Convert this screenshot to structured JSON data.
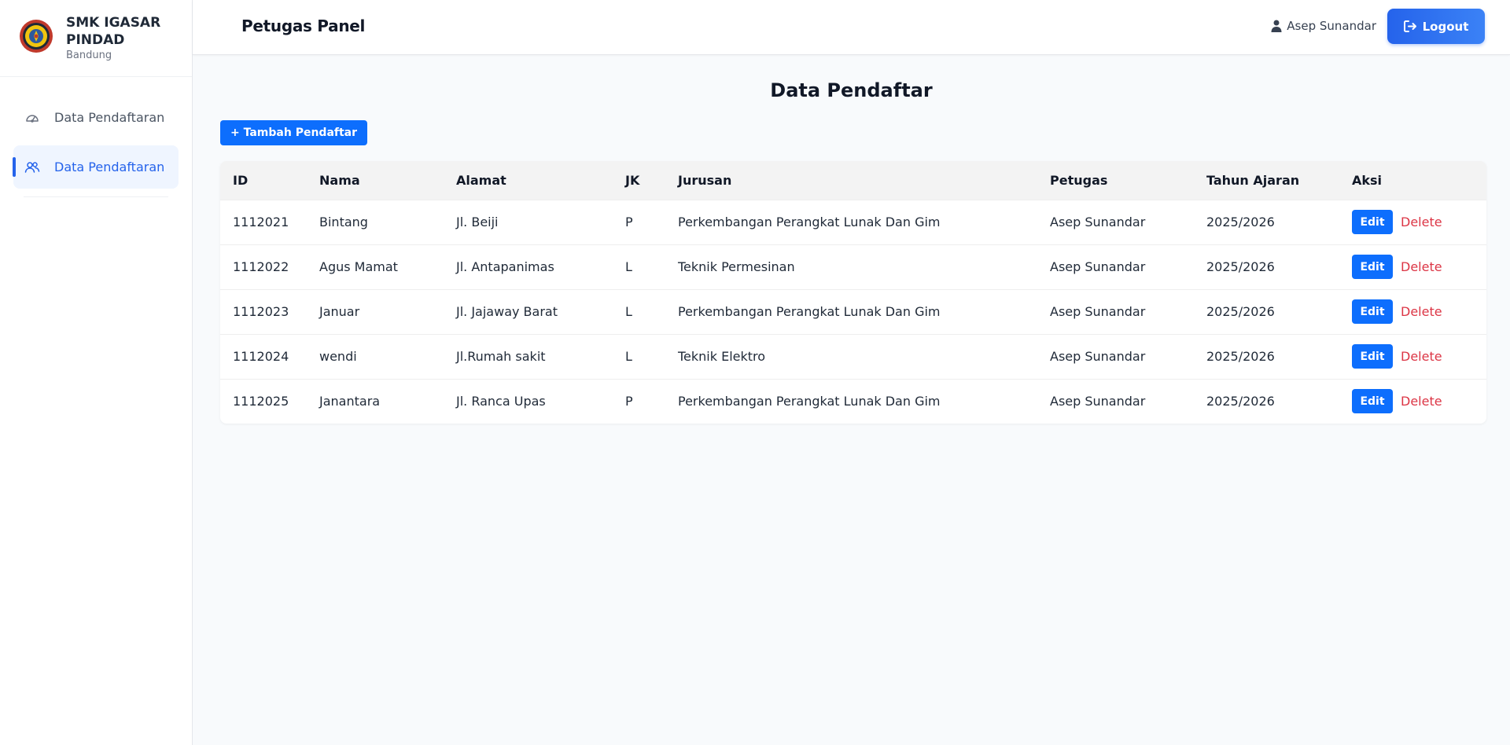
{
  "brand": {
    "name": "SMK IGASAR PINDAD",
    "subtitle": "Bandung"
  },
  "sidebar": {
    "items": [
      {
        "label": "Data Pendaftaran",
        "icon": "dashboard-gauge-icon",
        "active": false
      },
      {
        "label": "Data Pendaftaran",
        "icon": "users-icon",
        "active": true
      }
    ]
  },
  "header": {
    "title": "Petugas Panel",
    "user_name": "Asep Sunandar",
    "logout_label": "Logout"
  },
  "main": {
    "title": "Data Pendaftar",
    "add_button": "+ Tambah Pendaftar",
    "columns": [
      "ID",
      "Nama",
      "Alamat",
      "JK",
      "Jurusan",
      "Petugas",
      "Tahun Ajaran",
      "Aksi"
    ],
    "rows": [
      {
        "id": "1112021",
        "nama": "Bintang",
        "alamat": "Jl. Beiji",
        "jk": "P",
        "jurusan": "Perkembangan Perangkat Lunak Dan Gim",
        "petugas": "Asep Sunandar",
        "tahun": "2025/2026"
      },
      {
        "id": "1112022",
        "nama": "Agus Mamat",
        "alamat": "Jl. Antapanimas",
        "jk": "L",
        "jurusan": "Teknik Permesinan",
        "petugas": "Asep Sunandar",
        "tahun": "2025/2026"
      },
      {
        "id": "1112023",
        "nama": "Januar",
        "alamat": "Jl. Jajaway Barat",
        "jk": "L",
        "jurusan": "Perkembangan Perangkat Lunak Dan Gim",
        "petugas": "Asep Sunandar",
        "tahun": "2025/2026"
      },
      {
        "id": "1112024",
        "nama": "wendi",
        "alamat": "Jl.Rumah sakit",
        "jk": "L",
        "jurusan": "Teknik Elektro",
        "petugas": "Asep Sunandar",
        "tahun": "2025/2026"
      },
      {
        "id": "1112025",
        "nama": "Janantara",
        "alamat": "Jl. Ranca Upas",
        "jk": "P",
        "jurusan": "Perkembangan Perangkat Lunak Dan Gim",
        "petugas": "Asep Sunandar",
        "tahun": "2025/2026"
      }
    ],
    "edit_label": "Edit",
    "delete_label": "Delete"
  },
  "colors": {
    "primary": "#0d6efd",
    "accent": "#2563eb",
    "danger": "#dc3545"
  }
}
